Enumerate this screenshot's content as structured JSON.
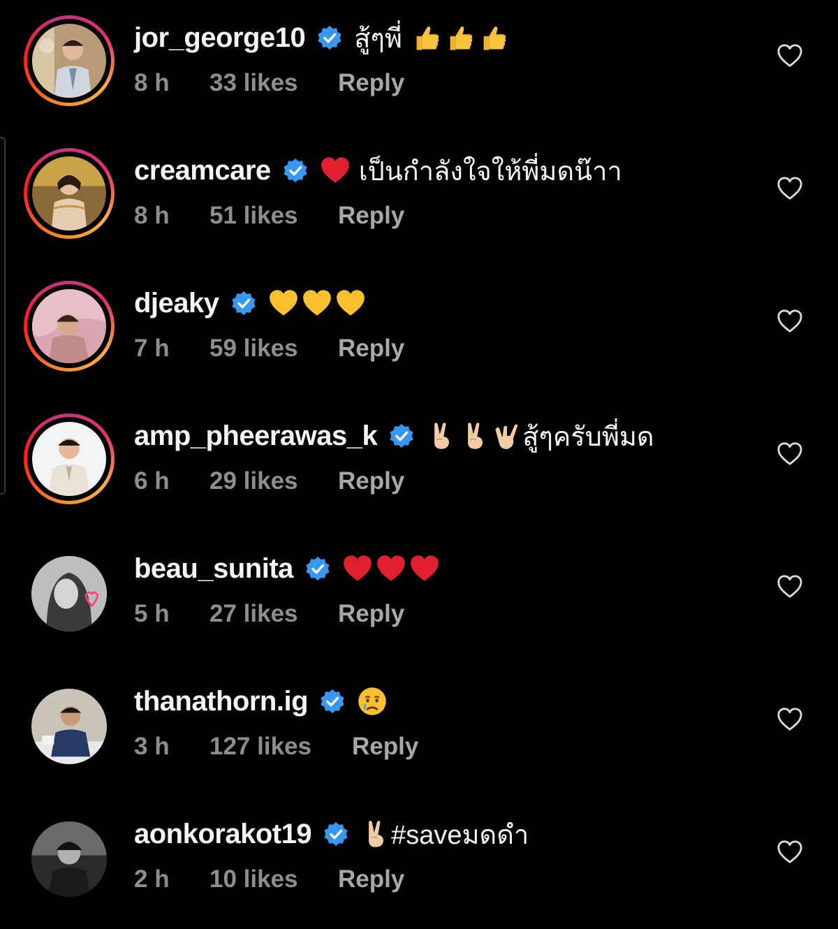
{
  "comments": [
    {
      "username": "jor_george10",
      "text": "สู้ๆพี่",
      "emojis": [
        "thumbs-up",
        "thumbs-up",
        "thumbs-up"
      ],
      "emoji_position": "after",
      "time": "8 h",
      "likes": "33 likes",
      "reply": "Reply",
      "avatar_ring": true
    },
    {
      "username": "creamcare",
      "text": "เป็นกำลังใจให้พี่มดน๊าา",
      "emojis": [
        "red-heart"
      ],
      "emoji_position": "before",
      "time": "8 h",
      "likes": "51 likes",
      "reply": "Reply",
      "avatar_ring": true
    },
    {
      "username": "djeaky",
      "text": "",
      "emojis": [
        "yellow-heart",
        "yellow-heart",
        "yellow-heart"
      ],
      "emoji_position": "before",
      "time": "7 h",
      "likes": "59 likes",
      "reply": "Reply",
      "avatar_ring": true
    },
    {
      "username": "amp_pheerawas_k",
      "text": "สู้ๆครับพี่มด",
      "emojis": [
        "victory-hand",
        "victory-hand",
        "love-you-hand"
      ],
      "emoji_position": "before",
      "time": "6 h",
      "likes": "29 likes",
      "reply": "Reply",
      "avatar_ring": true
    },
    {
      "username": "beau_sunita",
      "text": "",
      "emojis": [
        "red-heart",
        "red-heart",
        "red-heart"
      ],
      "emoji_position": "before",
      "time": "5 h",
      "likes": "27 likes",
      "reply": "Reply",
      "avatar_ring": false
    },
    {
      "username": "thanathorn.ig",
      "text": "",
      "emojis": [
        "crying-face"
      ],
      "emoji_position": "before",
      "time": "3 h",
      "likes": "127 likes",
      "reply": "Reply",
      "avatar_ring": false
    },
    {
      "username": "aonkorakot19",
      "text": "#saveมดดำ",
      "emojis": [
        "victory-hand"
      ],
      "emoji_position": "before",
      "time": "2 h",
      "likes": "10 likes",
      "reply": "Reply",
      "avatar_ring": false
    }
  ],
  "colors": {
    "background": "#000000",
    "username": "#f5f5f5",
    "meta": "#8e8e8e",
    "verified": "#3897f0",
    "heart_outline": "#dbdbdb"
  }
}
